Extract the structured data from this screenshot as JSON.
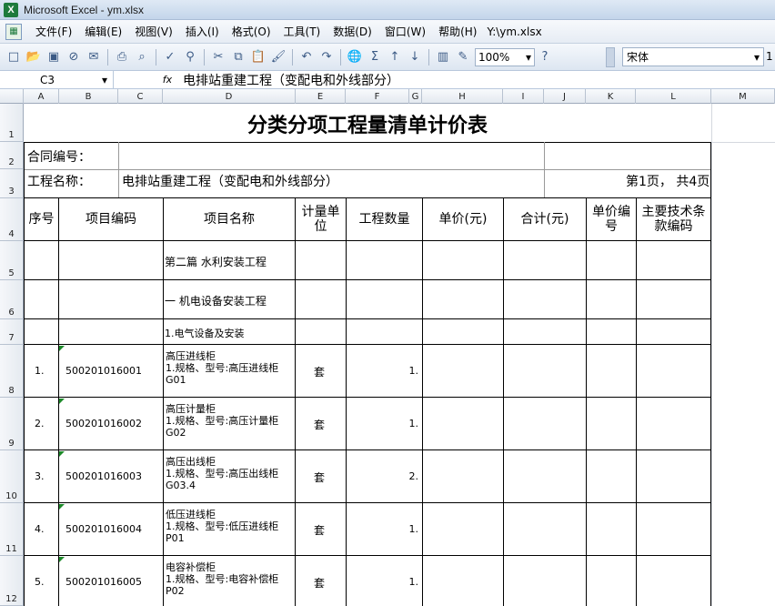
{
  "window": {
    "title": "Microsoft Excel - ym.xlsx"
  },
  "menu": {
    "items": [
      "文件(F)",
      "编辑(E)",
      "视图(V)",
      "插入(I)",
      "格式(O)",
      "工具(T)",
      "数据(D)",
      "窗口(W)",
      "帮助(H)"
    ],
    "path": "Y:\\ym.xlsx"
  },
  "toolbar": {
    "zoom": "100%",
    "font_name": "宋体",
    "font_size": "1"
  },
  "formula_bar": {
    "name_box": "C3",
    "fx": "fx",
    "content": "电排站重建工程（变配电和外线部分）"
  },
  "columns": [
    "A",
    "B",
    "C",
    "D",
    "E",
    "F",
    "G",
    "H",
    "I",
    "J",
    "K",
    "L",
    "M"
  ],
  "rows": [
    "1",
    "2",
    "3",
    "4",
    "5",
    "6",
    "7",
    "8",
    "9",
    "10",
    "11",
    "12"
  ],
  "sheet": {
    "title": "分类分项工程量清单计价表",
    "contract_label": "合同编号：",
    "project_label": "工程名称：",
    "project_name": "电排站重建工程（变配电和外线部分）",
    "page_info": "第1页， 共4页",
    "headers": [
      "序号",
      "项目编码",
      "项目名称",
      "计量单位",
      "工程数量",
      "单价(元)",
      "合计(元)",
      "单价编号",
      "主要技术条款编码"
    ],
    "section_rows": [
      "第二篇 水利安装工程",
      "一 机电设备安装工程",
      "1.电气设备及安装"
    ],
    "items": [
      {
        "no": "1.",
        "code": "500201016001",
        "name_line1": "高压进线柜",
        "name_line2": "1.规格、型号:高压进线柜",
        "name_line3": "G01",
        "unit": "套",
        "qty": "1."
      },
      {
        "no": "2.",
        "code": "500201016002",
        "name_line1": "高压计量柜",
        "name_line2": "1.规格、型号:高压计量柜",
        "name_line3": "G02",
        "unit": "套",
        "qty": "1."
      },
      {
        "no": "3.",
        "code": "500201016003",
        "name_line1": "高压出线柜",
        "name_line2": "1.规格、型号:高压出线柜",
        "name_line3": "G03.4",
        "unit": "套",
        "qty": "2."
      },
      {
        "no": "4.",
        "code": "500201016004",
        "name_line1": "低压进线柜",
        "name_line2": "1.规格、型号:低压进线柜",
        "name_line3": "P01",
        "unit": "套",
        "qty": "1."
      },
      {
        "no": "5.",
        "code": "500201016005",
        "name_line1": "电容补偿柜",
        "name_line2": "1.规格、型号:电容补偿柜",
        "name_line3": "P02",
        "unit": "套",
        "qty": "1."
      }
    ]
  }
}
